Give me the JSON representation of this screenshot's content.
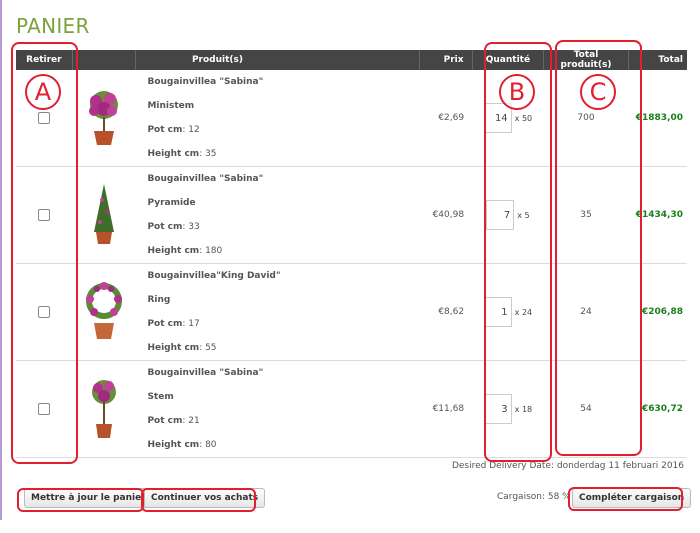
{
  "page": {
    "title": "PANIER"
  },
  "table": {
    "headers": {
      "retirer": "Retirer",
      "produits": "Produit(s)",
      "prix": "Prix",
      "quantite": "Quantité",
      "total_produits": "Total produit(s)",
      "total": "Total"
    },
    "rows": [
      {
        "name": "Bougainvillea \"Sabina\"",
        "type": "Ministem",
        "pot_label": "Pot cm",
        "pot_value": ": 12",
        "height_label": "Height cm",
        "height_value": ": 35",
        "price": "€2,69",
        "qty": "14",
        "mult": "x 50",
        "total_products": "700",
        "total": "€1883,00",
        "image_icon": "bougainvillea-ministem-icon"
      },
      {
        "name": "Bougainvillea \"Sabina\"",
        "type": "Pyramide",
        "pot_label": "Pot cm",
        "pot_value": ": 33",
        "height_label": "Height cm",
        "height_value": ": 180",
        "price": "€40,98",
        "qty": "7",
        "mult": "x 5",
        "total_products": "35",
        "total": "€1434,30",
        "image_icon": "bougainvillea-pyramid-icon"
      },
      {
        "name": "Bougainvillea\"King David\"",
        "type": "Ring",
        "pot_label": "Pot cm",
        "pot_value": ": 17",
        "height_label": "Height cm",
        "height_value": ": 55",
        "price": "€8,62",
        "qty": "1",
        "mult": "x 24",
        "total_products": "24",
        "total": "€206,88",
        "image_icon": "bougainvillea-ring-icon"
      },
      {
        "name": "Bougainvillea \"Sabina\"",
        "type": "Stem",
        "pot_label": "Pot cm",
        "pot_value": ": 21",
        "height_label": "Height cm",
        "height_value": ": 80",
        "price": "€11,68",
        "qty": "3",
        "mult": "x 18",
        "total_products": "54",
        "total": "€630,72",
        "image_icon": "bougainvillea-stem-icon"
      }
    ]
  },
  "delivery": {
    "text": "Desired Delivery Date: donderdag 11 februari 2016"
  },
  "buttons": {
    "update": "Mettre à jour le panier",
    "continue": "Continuer vos achats",
    "complete": "Compléter cargaison"
  },
  "cargaison": {
    "label": "Cargaison: 58 %"
  },
  "annotations": {
    "a": "A",
    "b": "B",
    "c": "C"
  },
  "colors": {
    "title": "#7aa33c",
    "header_bg": "#454545",
    "total_green": "#1a7f1a",
    "annotation_red": "#e02030",
    "flower_magenta": "#b0308a"
  }
}
